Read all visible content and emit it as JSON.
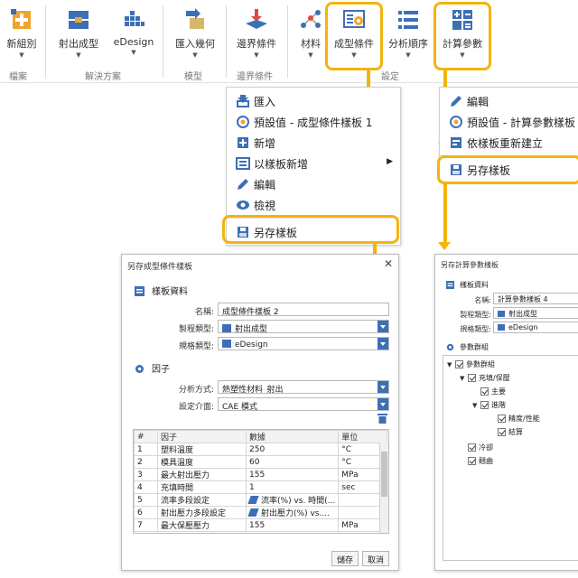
{
  "ribbon": {
    "buttons": [
      {
        "label": "新組別"
      },
      {
        "label": "射出成型"
      },
      {
        "label": "eDesign"
      },
      {
        "label": "匯入幾何"
      },
      {
        "label": "邊界條件"
      },
      {
        "label": "材料"
      },
      {
        "label": "成型條件"
      },
      {
        "label": "分析順序"
      },
      {
        "label": "計算參數"
      }
    ],
    "groups": {
      "file": "檔案",
      "solution": "解決方案",
      "model": "模型",
      "boundary": "邊界條件",
      "settings": "設定"
    },
    "accent_color": "#f3b40f"
  },
  "menu_left": {
    "items": [
      {
        "label": "匯入"
      },
      {
        "label": "預設值 - 成型條件樣板 1"
      },
      {
        "label": "新增"
      },
      {
        "label": "以樣板新增"
      },
      {
        "label": "編輯"
      },
      {
        "label": "檢視"
      },
      {
        "label": "另存樣板"
      }
    ]
  },
  "menu_right": {
    "items": [
      {
        "label": "編輯"
      },
      {
        "label": "預設值 - 計算參數樣板"
      },
      {
        "label": "依樣板重新建立"
      },
      {
        "label": "另存樣板"
      }
    ]
  },
  "dialog_left": {
    "title": "另存成型條件樣板",
    "section_template": "樣板資料",
    "name_label": "名稱:",
    "name_value": "成型條件樣板 2",
    "process_label": "製程類型:",
    "process_value": "射出成型",
    "spec_label": "規格類型:",
    "spec_value": "eDesign",
    "section_factor": "因子",
    "method_label": "分析方式:",
    "method_value": "熱塑性材料_射出",
    "interface_label": "設定介面:",
    "interface_value": "CAE 模式",
    "table": {
      "headers": [
        "#",
        "因子",
        "數據",
        "單位"
      ],
      "rows": [
        [
          "1",
          "塑料溫度",
          "250",
          "°C"
        ],
        [
          "2",
          "模具溫度",
          "60",
          "°C"
        ],
        [
          "3",
          "最大射出壓力",
          "155",
          "MPa"
        ],
        [
          "4",
          "充填時間",
          "1",
          "sec"
        ],
        [
          "5",
          "流率多段設定",
          "流率(%) vs. 時間(...",
          ""
        ],
        [
          "6",
          "射出壓力多段設定",
          "射出壓力(%) vs....",
          ""
        ],
        [
          "7",
          "最大保壓壓力",
          "155",
          "MPa"
        ]
      ]
    },
    "save_label": "儲存",
    "cancel_label": "取消"
  },
  "dialog_right": {
    "title": "另存計算參數樣板",
    "section_template": "樣板資料",
    "name_label": "名稱:",
    "name_value": "計算參數樣板 4",
    "process_label": "製程類型:",
    "process_value": "射出成型",
    "spec_label": "規格類型:",
    "spec_value": "eDesign",
    "section_params": "參數群組",
    "tree": [
      {
        "label": "參數群組"
      },
      {
        "label": "充填/保壓"
      },
      {
        "label": "主要"
      },
      {
        "label": "進階"
      },
      {
        "label": "精度/性能"
      },
      {
        "label": "結算"
      },
      {
        "label": "冷卻"
      },
      {
        "label": "翹曲"
      }
    ]
  }
}
